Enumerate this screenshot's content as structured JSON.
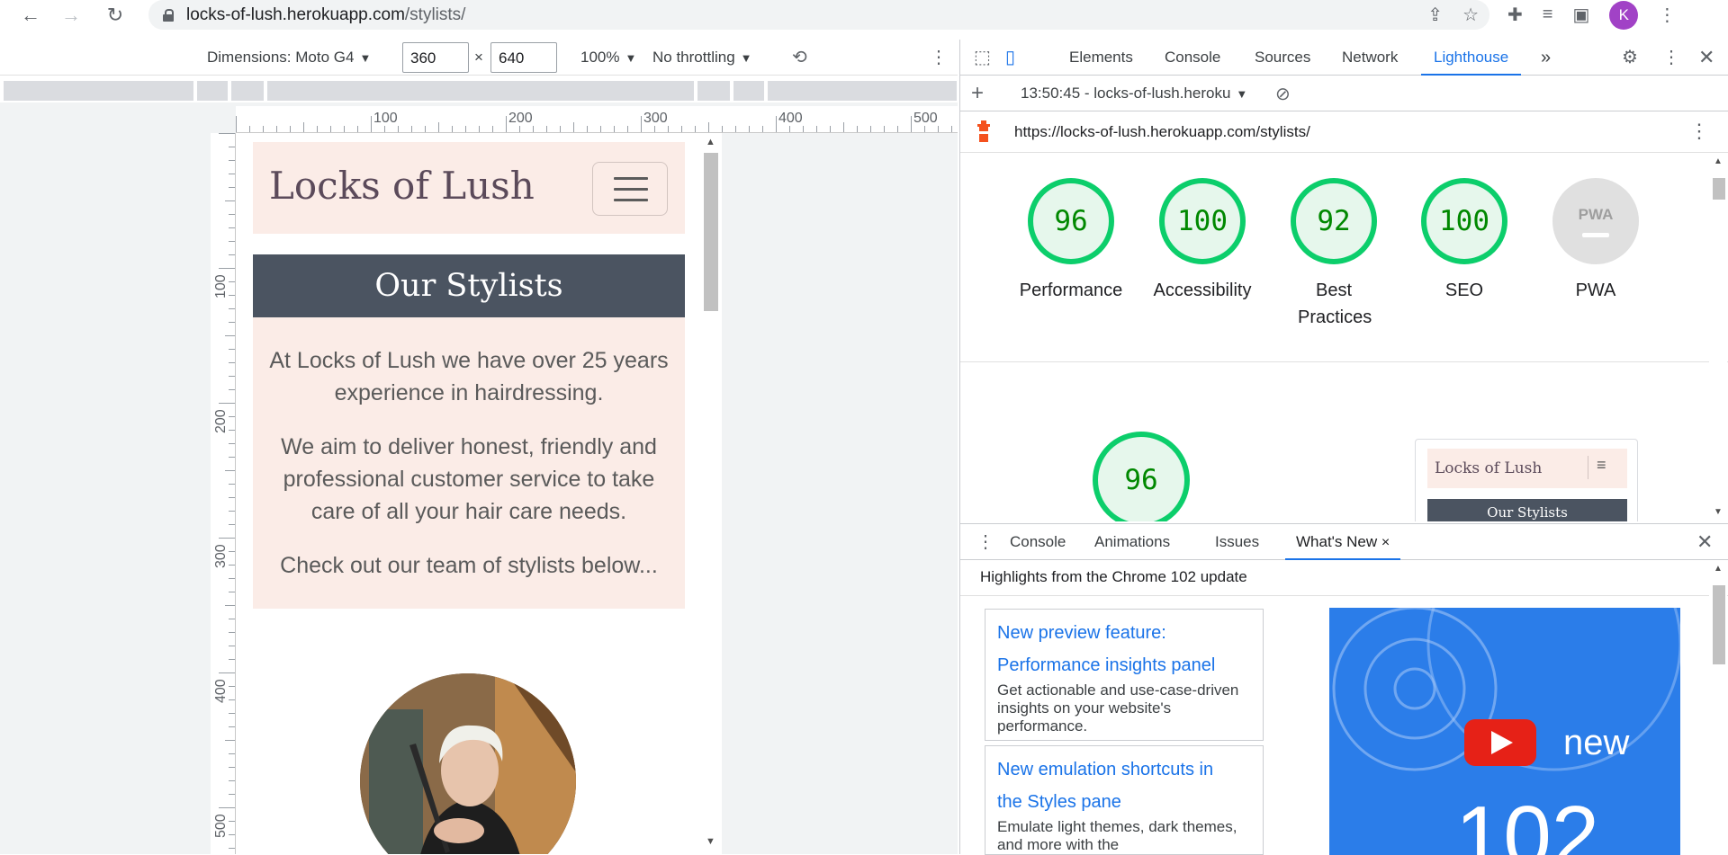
{
  "browser": {
    "url_host": "locks-of-lush.herokuapp.com",
    "url_path": "/stylists/",
    "avatar_letter": "K",
    "accent": "#a142c6"
  },
  "device_toolbar": {
    "dimensions_label": "Dimensions: Moto G4",
    "width": "360",
    "height": "640",
    "times": "×",
    "zoom": "100%",
    "throttling": "No throttling"
  },
  "rulers": {
    "top_labels": [
      "100",
      "200",
      "300",
      "400",
      "500"
    ],
    "left_labels": [
      "100",
      "200",
      "300",
      "400",
      "500"
    ]
  },
  "site": {
    "brand": "Locks of Lush",
    "page_title": "Our Stylists",
    "intro": [
      "At Locks of Lush we have over 25 years experience in hairdressing.",
      "We aim to deliver honest, friendly and professional customer service to take care of all your hair care needs.",
      "Check out our team of stylists below..."
    ],
    "header_bg": "#fbece7",
    "title_bg": "#4b5461"
  },
  "devtools": {
    "tabs": [
      "Elements",
      "Console",
      "Sources",
      "Network",
      "Lighthouse"
    ],
    "active_tab": "Lighthouse",
    "more": "»",
    "report_selector": "13:50:45 - locks-of-lush.heroku",
    "report_url": "https://locks-of-lush.herokuapp.com/stylists/",
    "scores": [
      {
        "label": "Performance",
        "value": "96"
      },
      {
        "label": "Accessibility",
        "value": "100"
      },
      {
        "label": "Best Practices",
        "value": "92"
      },
      {
        "label": "SEO",
        "value": "100"
      },
      {
        "label": "PWA",
        "value": "PWA"
      }
    ],
    "perf_score": "96",
    "thumb": {
      "brand": "Locks of Lush",
      "title": "Our Stylists"
    },
    "pass_color": "#0cce6b"
  },
  "drawer": {
    "tabs": [
      "Console",
      "Animations",
      "Issues",
      "What's New"
    ],
    "active_tab": "What's New",
    "close": "×",
    "headline": "Highlights from the Chrome 102 update",
    "cards": [
      {
        "title_1": "New preview feature:",
        "title_2": "Performance insights panel",
        "desc": "Get actionable and use-case-driven insights on your website's performance."
      },
      {
        "title_1": "New emulation shortcuts in",
        "title_2": "the Styles pane",
        "desc": "Emulate light themes, dark themes, and more with the"
      }
    ],
    "video": {
      "text1": "new",
      "text2": "102"
    }
  }
}
